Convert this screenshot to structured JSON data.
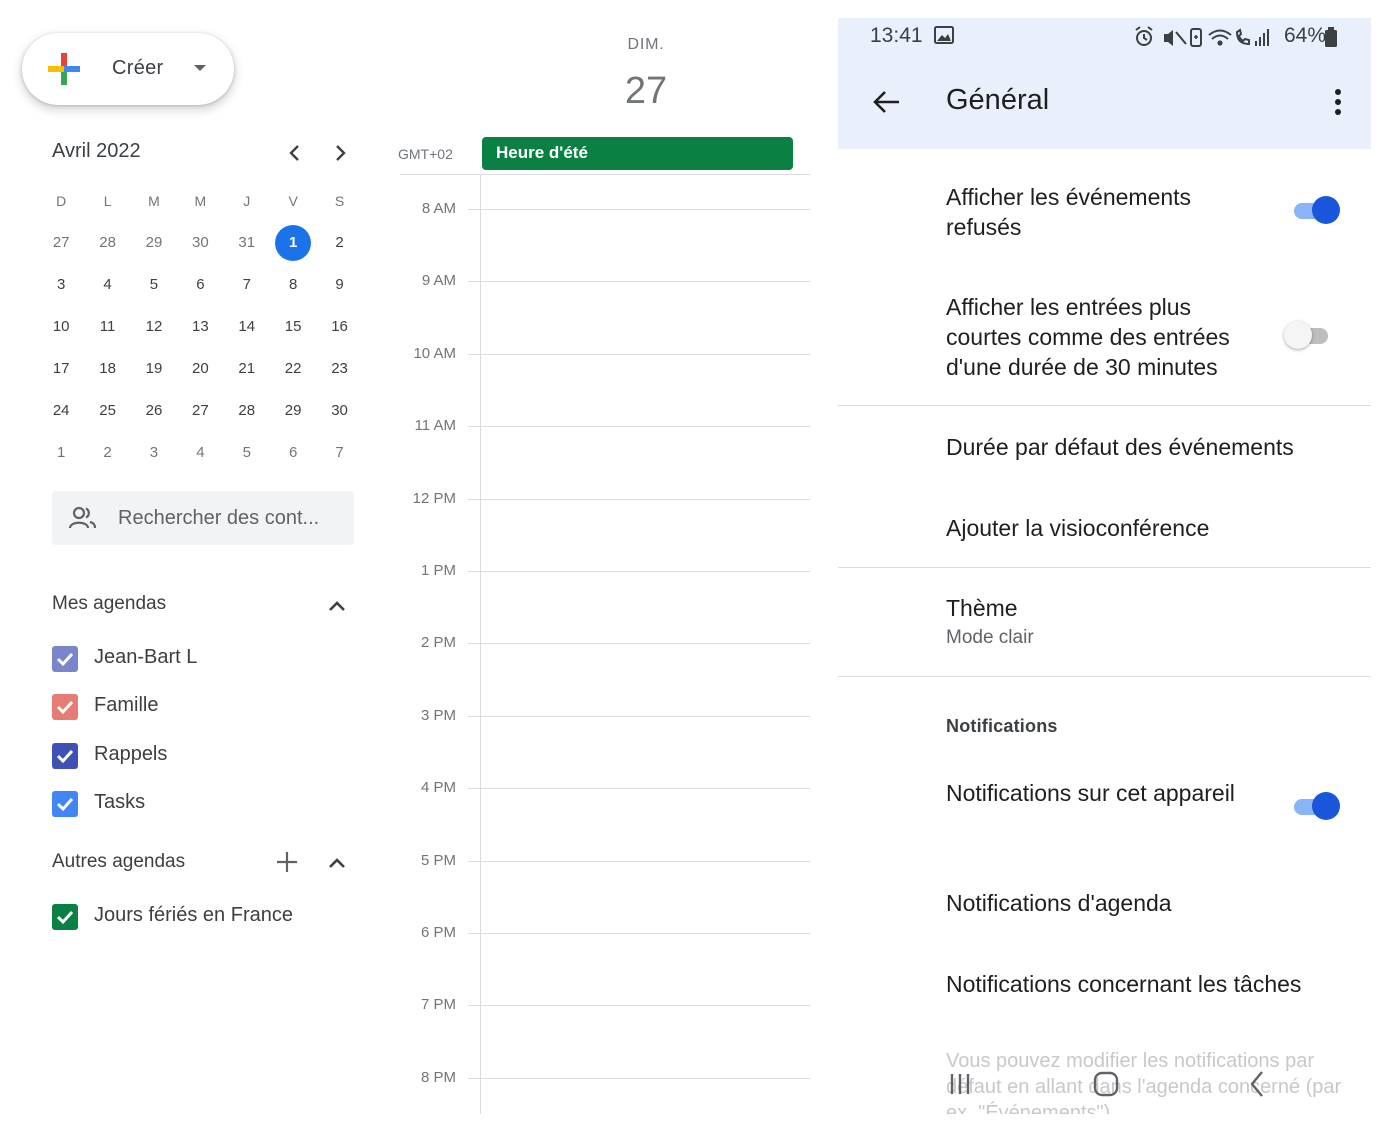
{
  "create_button": {
    "label": "Créer"
  },
  "mini_calendar": {
    "month_title": "Avril 2022",
    "weekday_headers": [
      "D",
      "L",
      "M",
      "M",
      "J",
      "V",
      "S"
    ],
    "weeks": [
      [
        "27",
        "28",
        "29",
        "30",
        "31",
        "1",
        "2"
      ],
      [
        "3",
        "4",
        "5",
        "6",
        "7",
        "8",
        "9"
      ],
      [
        "10",
        "11",
        "12",
        "13",
        "14",
        "15",
        "16"
      ],
      [
        "17",
        "18",
        "19",
        "20",
        "21",
        "22",
        "23"
      ],
      [
        "24",
        "25",
        "26",
        "27",
        "28",
        "29",
        "30"
      ],
      [
        "1",
        "2",
        "3",
        "4",
        "5",
        "6",
        "7"
      ]
    ],
    "today": "1"
  },
  "search_contacts": {
    "placeholder": "Rechercher des cont..."
  },
  "my_calendars": {
    "title": "Mes agendas",
    "items": [
      {
        "name": "Jean-Bart L",
        "color": "#7986cb"
      },
      {
        "name": "Famille",
        "color": "#e67c73"
      },
      {
        "name": "Rappels",
        "color": "#3f51b5"
      },
      {
        "name": "Tasks",
        "color": "#4285f4"
      }
    ]
  },
  "other_calendars": {
    "title": "Autres agendas",
    "items": [
      {
        "name": "Jours fériés en France",
        "color": "#0b8043"
      }
    ]
  },
  "day_view": {
    "day_name": "DIM.",
    "day_number": "27",
    "timezone": "GMT+02",
    "all_day_event": {
      "title": "Heure d'été",
      "color": "#0b8043"
    },
    "hours": [
      "8 AM",
      "9 AM",
      "10 AM",
      "11 AM",
      "12 PM",
      "1 PM",
      "2 PM",
      "3 PM",
      "4 PM",
      "5 PM",
      "6 PM",
      "7 PM",
      "8 PM"
    ]
  },
  "phone": {
    "status_bar": {
      "time": "13:41",
      "battery": "64%"
    },
    "title": "Général",
    "settings": {
      "show_declined": "Afficher les événements refusés",
      "show_declined_on": true,
      "short_entries": "Afficher les entrées plus courtes comme des entrées d'une durée de 30 minutes",
      "short_entries_on": false,
      "default_duration": "Durée par défaut des événements",
      "add_conferencing": "Ajouter la visioconférence",
      "theme": "Thème",
      "theme_value": "Mode clair",
      "notifications_section": "Notifications",
      "device_notifications": "Notifications sur cet appareil",
      "device_notifications_on": true,
      "calendar_notifications": "Notifications d'agenda",
      "task_notifications": "Notifications concernant les tâches",
      "footer_note": "Vous pouvez modifier les notifications par défaut en allant dans l'agenda concerné (par ex. \"Événements\")."
    }
  }
}
